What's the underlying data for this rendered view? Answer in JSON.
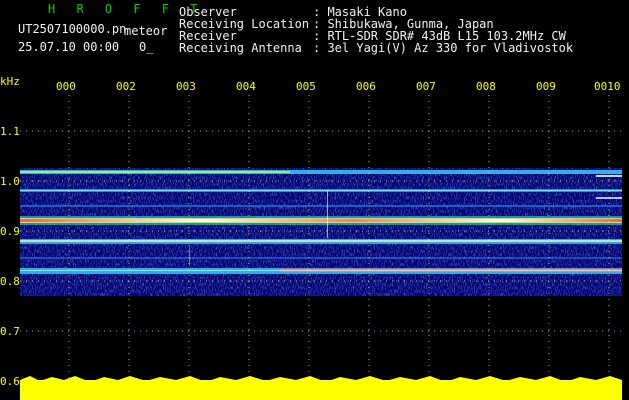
{
  "header": {
    "app_title": "H R O F F T",
    "filename": "UT2507100000.png",
    "mode": "meteor",
    "datetime": "25.07.10 00:00",
    "count": "0_",
    "info_labels": [
      "Observer",
      "Receiving Location",
      "Receiver",
      "Receiving Antenna"
    ],
    "info_values": [
      ": Masaki Kano",
      ": Shibukawa, Gunma, Japan",
      ": RTL-SDR SDR# 43dB L15 103.2MHz CW",
      ": 3el Yagi(V) Az 330 for Vladivostok"
    ]
  },
  "axis": {
    "y_unit": "kHz",
    "y_ticks": [
      "1.1",
      "1.0",
      "0.9",
      "0.8",
      "0.7",
      "0.6"
    ],
    "x_ticks": [
      "000",
      "002",
      "003",
      "004",
      "005",
      "006",
      "007",
      "008",
      "009",
      "0010"
    ]
  },
  "colors": {
    "background": "#000000",
    "plot_background": "#000066",
    "axis_label": "#ffff00",
    "title": "#00d000",
    "text": "#f2f2f2"
  }
}
